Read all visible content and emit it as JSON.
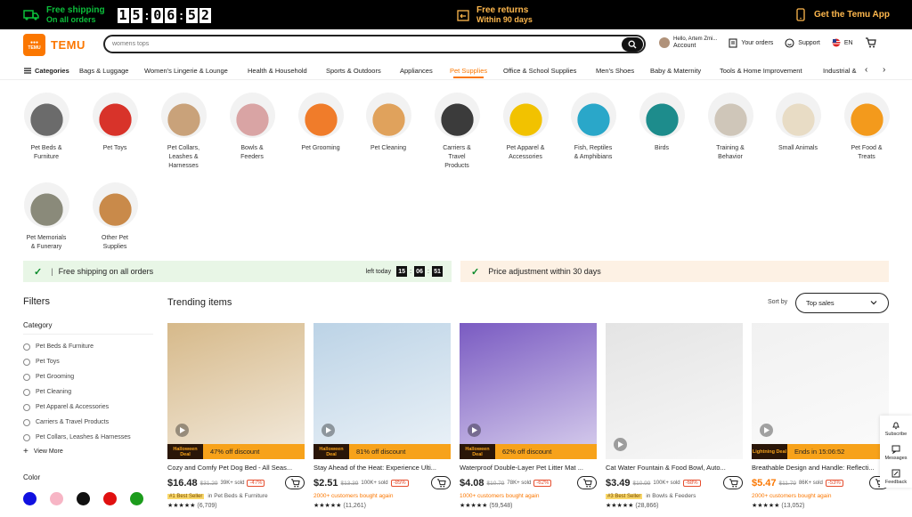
{
  "topbar": {
    "shipping_title": "Free shipping",
    "shipping_sub": "On all orders",
    "timer": [
      "1",
      "5",
      "0",
      "6",
      "5",
      "2"
    ],
    "returns_title": "Free returns",
    "returns_sub": "Within 90 days",
    "app_label": "Get the Temu App"
  },
  "header": {
    "logo_text": "TEMU",
    "search_placeholder": "womens tops",
    "greeting": "Hello, Artem Zmi...",
    "account": "Account",
    "orders": "Your orders",
    "support": "Support",
    "language": "EN"
  },
  "nav": {
    "categories_label": "Categories",
    "items": [
      "Bags & Luggage",
      "Women's Lingerie & Lounge",
      "Health & Household",
      "Sports & Outdoors",
      "Appliances",
      "Pet Supplies",
      "Office & School Supplies",
      "Men's Shoes",
      "Baby & Maternity",
      "Tools & Home Improvement",
      "Industrial &"
    ]
  },
  "subcategories": [
    {
      "label": "Pet Beds &\nFurniture",
      "color": "#6b6b6b"
    },
    {
      "label": "Pet Toys",
      "color": "#d8332a"
    },
    {
      "label": "Pet Collars,\nLeashes &\nHarnesses",
      "color": "#c9a27a"
    },
    {
      "label": "Bowls &\nFeeders",
      "color": "#d9a4a4"
    },
    {
      "label": "Pet Grooming",
      "color": "#f07c2a"
    },
    {
      "label": "Pet Cleaning",
      "color": "#e0a25c"
    },
    {
      "label": "Carriers &\nTravel\nProducts",
      "color": "#3b3b3b"
    },
    {
      "label": "Pet Apparel &\nAccessories",
      "color": "#f2c200"
    },
    {
      "label": "Fish, Reptiles\n& Amphibians",
      "color": "#2aa7c9"
    },
    {
      "label": "Birds",
      "color": "#1d8c8c"
    },
    {
      "label": "Training &\nBehavior",
      "color": "#cfc6b9"
    },
    {
      "label": "Small Animals",
      "color": "#e8dcc5"
    },
    {
      "label": "Pet Food &\nTreats",
      "color": "#f39a1c"
    },
    {
      "label": "Pet Memorials\n& Funerary",
      "color": "#8a8a7a"
    },
    {
      "label": "Other Pet\nSupplies",
      "color": "#c98a4a"
    }
  ],
  "banners": {
    "free_shipping": "Free shipping on all orders",
    "left_today": "left today",
    "countdown": [
      "15",
      "06",
      "51"
    ],
    "price_adjust": "Price adjustment within 30 days"
  },
  "filters": {
    "title": "Filters",
    "category_title": "Category",
    "categories": [
      "Pet Beds & Furniture",
      "Pet Toys",
      "Pet Grooming",
      "Pet Cleaning",
      "Pet Apparel & Accessories",
      "Carriers & Travel Products",
      "Pet Collars, Leashes & Harnesses"
    ],
    "view_more": "View More",
    "color_title": "Color",
    "colors": [
      "#1010e0",
      "#f7b5c5",
      "#111111",
      "#e01010",
      "#1c9c1c"
    ]
  },
  "trending": {
    "title": "Trending items",
    "sort_label": "Sort by",
    "sort_value": "Top sales"
  },
  "products": [
    {
      "title": "Cozy and Comfy Pet Dog Bed - All Seas...",
      "price": "$16.48",
      "orig": "$31.29",
      "sold": "39K+ sold",
      "pct": "-47%",
      "banner_tag": "Halloween Deal",
      "banner": "47% off discount",
      "badge_tag": "#1 Best Seller",
      "badge": "in Pet Beds & Furniture",
      "rating": "★★★★★",
      "reviews": "(6,709)",
      "bg": "#d6b98a",
      "price_color": "#222"
    },
    {
      "title": "Stay Ahead of the Heat: Experience Ulti...",
      "price": "$2.51",
      "orig": "$13.39",
      "sold": "100K+ sold",
      "pct": "-85%",
      "banner_tag": "Halloween Deal",
      "banner": "81% off discount",
      "badge_tag": "",
      "badge": "2000+ customers bought again",
      "rating": "★★★★★",
      "reviews": "(11,261)",
      "bg": "#bcd3e6",
      "price_color": "#222"
    },
    {
      "title": "Waterproof Double-Layer Pet Litter Mat ...",
      "price": "$4.08",
      "orig": "$10.79",
      "sold": "78K+ sold",
      "pct": "-62%",
      "banner_tag": "Halloween Deal",
      "banner": "62% off discount",
      "badge_tag": "",
      "badge": "1000+ customers bought again",
      "rating": "★★★★★",
      "reviews": "(59,548)",
      "bg": "#7a5bc2",
      "price_color": "#222"
    },
    {
      "title": "Cat Water Fountain & Food Bowl, Auto...",
      "price": "$3.49",
      "orig": "$10.99",
      "sold": "100K+ sold",
      "pct": "-68%",
      "banner_tag": "",
      "banner": "",
      "badge_tag": "#3 Best Seller",
      "badge": "in Bowls & Feeders",
      "rating": "★★★★★",
      "reviews": "(28,866)",
      "bg": "#e4e4e4",
      "price_color": "#222"
    },
    {
      "title": "Breathable Design and Handle: Reflecti...",
      "price": "$5.47",
      "orig": "$11.79",
      "sold": "86K+ sold",
      "pct": "-53%",
      "banner_tag": "Lightning Deal",
      "banner": "Ends in 15:06:52",
      "badge_tag": "",
      "badge": "2000+ customers bought again",
      "rating": "★★★★★",
      "reviews": "(13,052)",
      "bg": "#f1f1f1",
      "price_color": "#fb7701"
    }
  ],
  "side": {
    "subscribe": "Subscribe",
    "messages": "Messages",
    "feedback": "Feedback"
  }
}
